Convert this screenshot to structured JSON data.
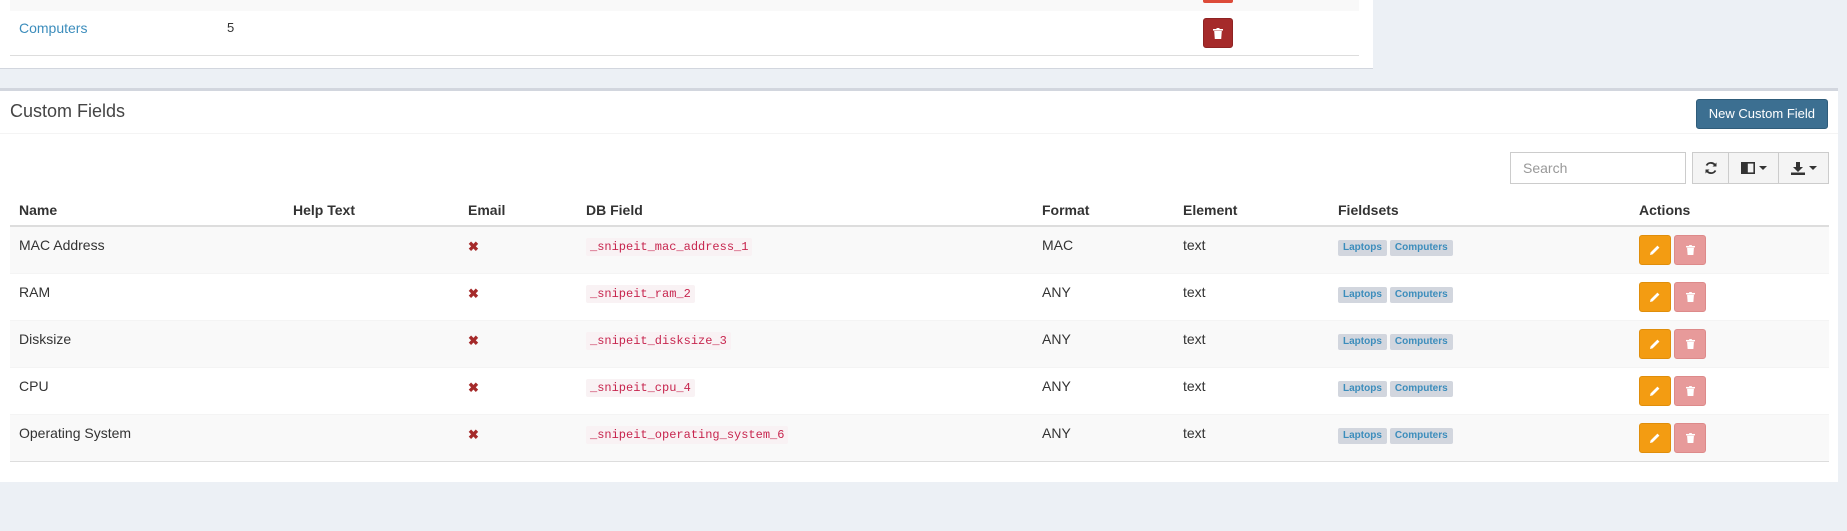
{
  "fieldsets_table": {
    "row": {
      "name": "Computers",
      "count": "5"
    }
  },
  "custom_fields": {
    "title": "Custom Fields",
    "new_button": "New Custom Field",
    "search_placeholder": "Search",
    "columns": [
      "Name",
      "Help Text",
      "Email",
      "DB Field",
      "Format",
      "Element",
      "Fieldsets",
      "Actions"
    ],
    "rows": [
      {
        "name": "MAC Address",
        "help_text": "",
        "db_field": "_snipeit_mac_address_1",
        "format": "MAC",
        "element": "text",
        "fieldsets": [
          "Laptops",
          "Computers"
        ]
      },
      {
        "name": "RAM",
        "help_text": "",
        "db_field": "_snipeit_ram_2",
        "format": "ANY",
        "element": "text",
        "fieldsets": [
          "Laptops",
          "Computers"
        ]
      },
      {
        "name": "Disksize",
        "help_text": "",
        "db_field": "_snipeit_disksize_3",
        "format": "ANY",
        "element": "text",
        "fieldsets": [
          "Laptops",
          "Computers"
        ]
      },
      {
        "name": "CPU",
        "help_text": "",
        "db_field": "_snipeit_cpu_4",
        "format": "ANY",
        "element": "text",
        "fieldsets": [
          "Laptops",
          "Computers"
        ]
      },
      {
        "name": "Operating System",
        "help_text": "",
        "db_field": "_snipeit_operating_system_6",
        "format": "ANY",
        "element": "text",
        "fieldsets": [
          "Laptops",
          "Computers"
        ]
      }
    ]
  },
  "icons": {
    "refresh": "refresh-icon",
    "columns": "columns-icon",
    "export": "download-icon",
    "email_flag": "times-icon",
    "edit": "pencil-icon",
    "delete": "trash-icon"
  },
  "colors": {
    "link": "#3c8dbc",
    "primary_button": "#3c6f91",
    "edit_button": "#f39c12",
    "delete_button": "#a52a2a",
    "code_text": "#c7254e"
  }
}
